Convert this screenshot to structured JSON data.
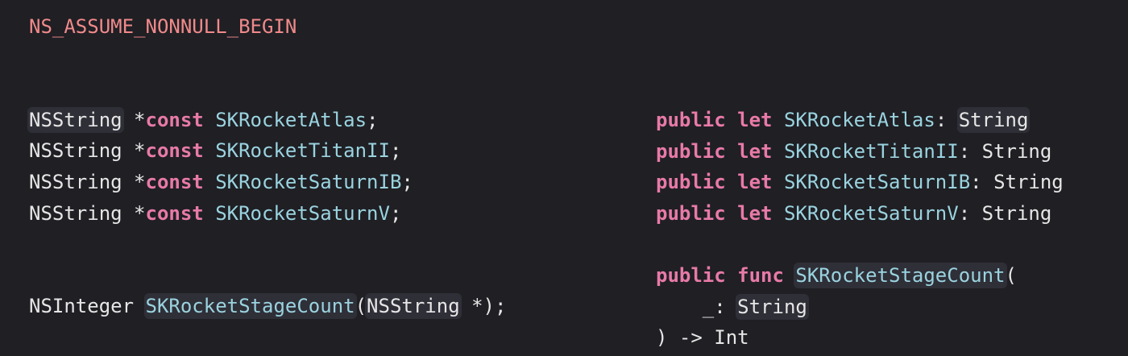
{
  "left": {
    "macro_line": "NS_ASSUME_NONNULL_BEGIN",
    "decls": [
      {
        "type": "NSString",
        "ptr": " *",
        "kw": "const",
        "name": "SKRocketAtlas",
        "end": ";"
      },
      {
        "type": "NSString",
        "ptr": " *",
        "kw": "const",
        "name": "SKRocketTitanII",
        "end": ";"
      },
      {
        "type": "NSString",
        "ptr": " *",
        "kw": "const",
        "name": "SKRocketSaturnIB",
        "end": ";"
      },
      {
        "type": "NSString",
        "ptr": " *",
        "kw": "const",
        "name": "SKRocketSaturnV",
        "end": ";"
      }
    ],
    "func": {
      "return_type": "NSInteger",
      "name": "SKRocketStageCount",
      "open": "(",
      "param_type": "NSString",
      "param_rest": " *);"
    }
  },
  "right": {
    "decls": [
      {
        "kw1": "public",
        "kw2": "let",
        "name": "SKRocketAtlas",
        "colon": ":",
        "type": "String"
      },
      {
        "kw1": "public",
        "kw2": "let",
        "name": "SKRocketTitanII",
        "colon": ":",
        "type": "String"
      },
      {
        "kw1": "public",
        "kw2": "let",
        "name": "SKRocketSaturnIB",
        "colon": ":",
        "type": "String"
      },
      {
        "kw1": "public",
        "kw2": "let",
        "name": "SKRocketSaturnV",
        "colon": ":",
        "type": "String"
      }
    ],
    "func": {
      "kw1": "public",
      "kw2": "func",
      "name": "SKRocketStageCount",
      "open": "(",
      "param_label": "_",
      "param_colon": ":",
      "param_type": "String",
      "close": ") -> Int"
    }
  }
}
